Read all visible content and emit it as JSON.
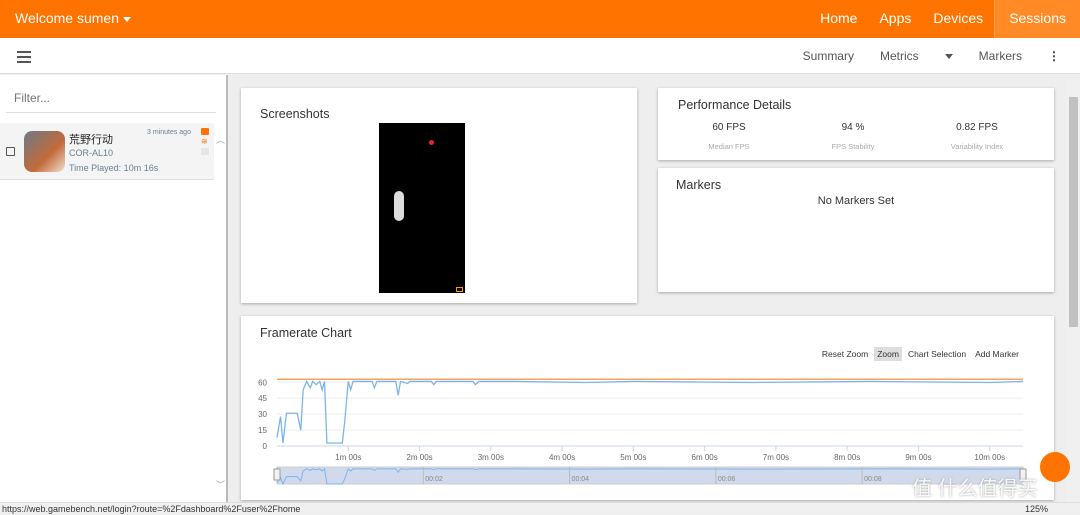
{
  "topbar": {
    "welcome": "Welcome sumen",
    "nav": [
      "Home",
      "Apps",
      "Devices",
      "Sessions"
    ],
    "active": "Sessions",
    "color": "#ff7300"
  },
  "subbar": {
    "items": [
      "Summary",
      "Metrics",
      "Markers"
    ]
  },
  "sidebar": {
    "filter_placeholder": "Filter...",
    "session": {
      "name": "荒野行动",
      "device": "COR-AL10",
      "time_played": "Time Played: 10m 16s",
      "ago": "3 minutes ago"
    }
  },
  "screenshots": {
    "title": "Screenshots"
  },
  "performance": {
    "title": "Performance Details",
    "stats": [
      {
        "value": "60 FPS",
        "label": "Median FPS"
      },
      {
        "value": "94 %",
        "label": "FPS Stability"
      },
      {
        "value": "0.82 FPS",
        "label": "Variability Index"
      }
    ]
  },
  "markers": {
    "title": "Markers",
    "empty": "No Markers Set"
  },
  "framerate": {
    "title": "Framerate Chart",
    "tools": [
      "Reset Zoom",
      "Zoom",
      "Chart Selection",
      "Add Marker"
    ],
    "active_tool": "Zoom"
  },
  "chart_data": {
    "type": "line",
    "title": "Framerate Chart",
    "yticks": [
      60,
      45,
      30,
      15,
      0
    ],
    "ylim": [
      0,
      65
    ],
    "xlim": [
      0,
      628
    ],
    "xticks": [
      {
        "t": 60,
        "label": "1m 00s"
      },
      {
        "t": 120,
        "label": "2m 00s"
      },
      {
        "t": 180,
        "label": "3m 00s"
      },
      {
        "t": 240,
        "label": "4m 00s"
      },
      {
        "t": 300,
        "label": "5m 00s"
      },
      {
        "t": 360,
        "label": "6m 00s"
      },
      {
        "t": 420,
        "label": "7m 00s"
      },
      {
        "t": 480,
        "label": "8m 00s"
      },
      {
        "t": 540,
        "label": "9m 00s"
      },
      {
        "t": 600,
        "label": "10m 00s"
      }
    ],
    "navigator_ticks": [
      "00:02",
      "00:04",
      "00:06",
      "00:08"
    ],
    "target_fps": 60,
    "target_color": "#f5a35c",
    "series_color": "#7cb5ec",
    "grid": true,
    "points": [
      [
        0,
        5
      ],
      [
        3,
        25
      ],
      [
        5,
        0
      ],
      [
        8,
        28
      ],
      [
        17,
        28
      ],
      [
        20,
        12
      ],
      [
        22,
        50
      ],
      [
        25,
        58
      ],
      [
        28,
        52
      ],
      [
        30,
        58
      ],
      [
        33,
        55
      ],
      [
        36,
        58
      ],
      [
        38,
        50
      ],
      [
        40,
        58
      ],
      [
        42,
        0
      ],
      [
        55,
        0
      ],
      [
        57,
        20
      ],
      [
        60,
        58
      ],
      [
        62,
        50
      ],
      [
        64,
        58
      ],
      [
        80,
        58
      ],
      [
        82,
        52
      ],
      [
        84,
        58
      ],
      [
        100,
        58
      ],
      [
        102,
        45
      ],
      [
        104,
        58
      ],
      [
        110,
        56
      ],
      [
        112,
        58
      ],
      [
        130,
        58
      ],
      [
        132,
        55
      ],
      [
        134,
        58
      ],
      [
        165,
        58
      ],
      [
        167,
        55
      ],
      [
        170,
        58
      ],
      [
        200,
        58
      ],
      [
        260,
        57
      ],
      [
        300,
        58
      ],
      [
        400,
        57
      ],
      [
        500,
        58
      ],
      [
        600,
        57
      ],
      [
        628,
        58
      ]
    ]
  },
  "status": {
    "url": "https://web.gamebench.net/login?route=%2Fdashboard%2Fuser%2Fhome",
    "zoom": "125%"
  },
  "watermark": "值 什么值得买"
}
